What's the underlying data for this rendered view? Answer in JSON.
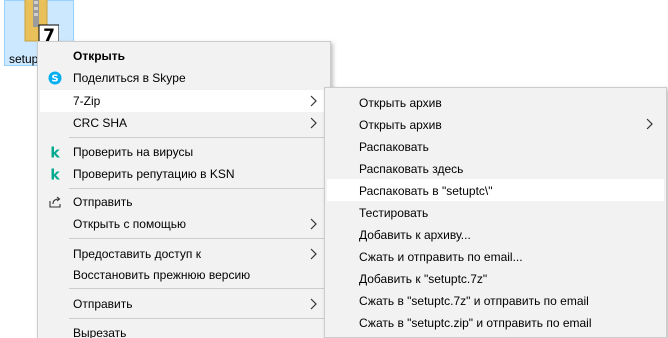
{
  "desktop": {
    "file_label": "setup"
  },
  "menu": {
    "items": [
      {
        "label": "Открыть",
        "bold": true,
        "icon": "none"
      },
      {
        "label": "Поделиться в Skype",
        "icon": "skype-icon"
      },
      {
        "label": "7-Zip",
        "icon": "none",
        "submenu": true
      },
      {
        "label": "CRC SHA",
        "icon": "none",
        "submenu": true
      },
      {
        "label": "Проверить на вирусы",
        "icon": "kaspersky-icon"
      },
      {
        "label": "Проверить репутацию в KSN",
        "icon": "kaspersky-icon"
      },
      {
        "label": "Отправить",
        "icon": "share-icon"
      },
      {
        "label": "Открыть с помощью",
        "icon": "none",
        "submenu": true
      },
      {
        "label": "Предоставить доступ к",
        "icon": "none",
        "submenu": true
      },
      {
        "label": "Восстановить прежнюю версию",
        "icon": "none"
      },
      {
        "label": "Отправить",
        "icon": "none",
        "submenu": true
      },
      {
        "label": "Вырезать",
        "icon": "none"
      }
    ]
  },
  "submenu": {
    "items": [
      {
        "label": "Открыть архив"
      },
      {
        "label": "Открыть архив",
        "submenu": true
      },
      {
        "label": "Распаковать"
      },
      {
        "label": "Распаковать здесь"
      },
      {
        "label": "Распаковать в \"setuptc\\\"",
        "highlighted": true
      },
      {
        "label": "Тестировать"
      },
      {
        "label": "Добавить к архиву..."
      },
      {
        "label": "Сжать и отправить по email..."
      },
      {
        "label": "Добавить к \"setuptc.7z\""
      },
      {
        "label": "Сжать в \"setuptc.7z\" и отправить по email"
      },
      {
        "label": "Сжать в \"setuptc.zip\" и отправить по email"
      }
    ]
  },
  "colors": {
    "menu_bg": "#f2f2f2",
    "highlight": "#ffffff",
    "skype": "#00aff0",
    "kaspersky": "#00a88e",
    "selection": "#cce8ff"
  }
}
